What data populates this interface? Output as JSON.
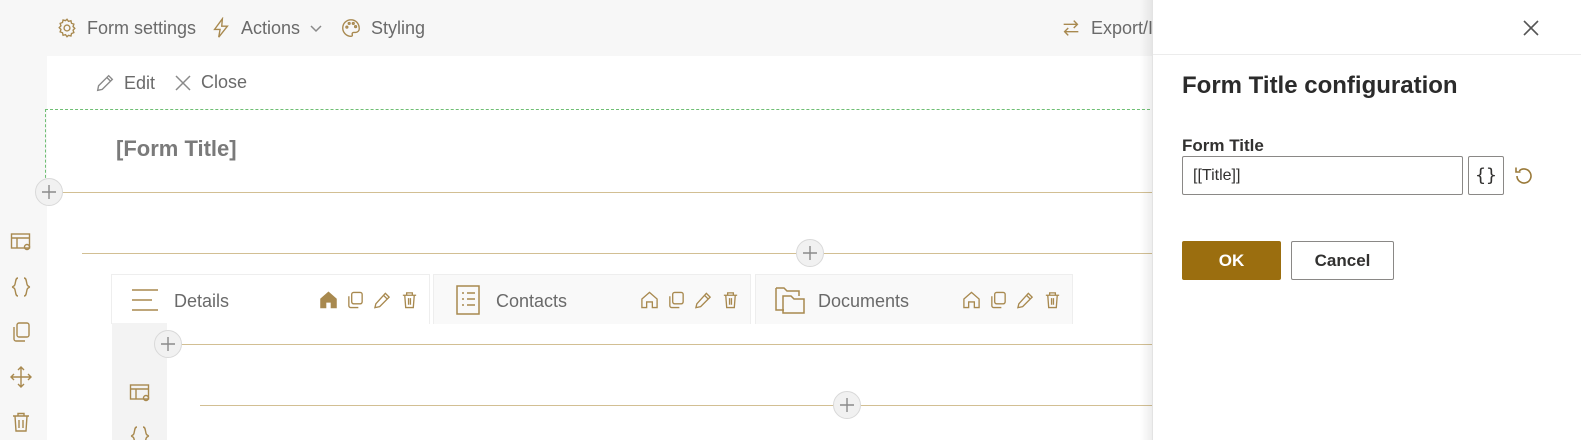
{
  "toolbar": {
    "form_settings": "Form settings",
    "actions": "Actions",
    "styling": "Styling",
    "export": "Export/I"
  },
  "edit_bar": {
    "edit": "Edit",
    "close": "Close"
  },
  "form": {
    "title_placeholder": "[Form Title]"
  },
  "tabs": [
    {
      "label": "Details",
      "icon": "menu-lines-icon",
      "active": true
    },
    {
      "label": "Contacts",
      "icon": "list-document-icon",
      "active": false
    },
    {
      "label": "Documents",
      "icon": "folders-icon",
      "active": false
    }
  ],
  "panel": {
    "title": "Form Title configuration",
    "field_label": "Form Title",
    "field_value": "[[Title]]",
    "expression_button": "{}",
    "ok_label": "OK",
    "cancel_label": "Cancel"
  },
  "colors": {
    "accent": "#9b6e0f",
    "icon_gold": "#a8894f",
    "divider": "#d2bf93",
    "selection_border": "#6fbf74"
  }
}
